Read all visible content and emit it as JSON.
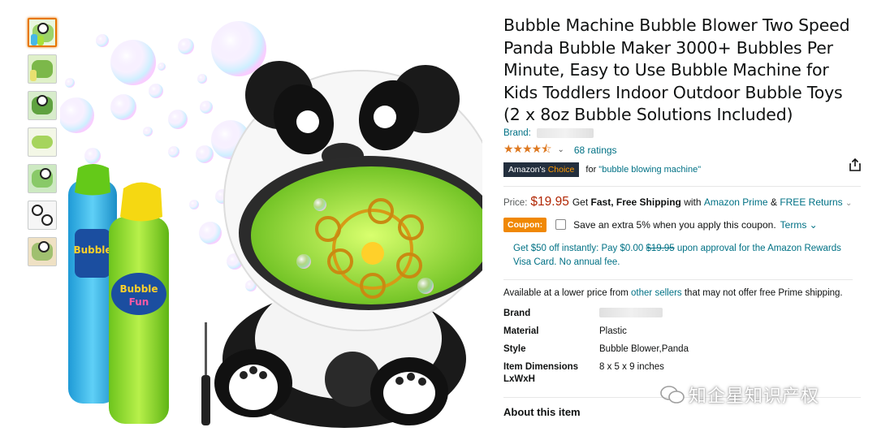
{
  "thumbnails": [
    {
      "label": "thumbnail-1",
      "selected": true
    },
    {
      "label": "thumbnail-2",
      "selected": false
    },
    {
      "label": "thumbnail-3",
      "selected": false
    },
    {
      "label": "thumbnail-4",
      "selected": false
    },
    {
      "label": "thumbnail-5",
      "selected": false
    },
    {
      "label": "thumbnail-6",
      "selected": false
    },
    {
      "label": "thumbnail-7",
      "selected": false
    }
  ],
  "main_image": {
    "bottle_label_1": "Bubble",
    "bottle_label_2": "Fun"
  },
  "product": {
    "title": "Bubble Machine Bubble Blower Two Speed Panda Bubble Maker 3000+ Bubbles Per Minute, Easy to Use Bubble Machine for Kids Toddlers Indoor Outdoor Bubble Toys (2 x 8oz Bubble Solutions Included)",
    "brand_label": "Brand:",
    "rating_stars": "★★★★⯪",
    "rating_chevron": "⌄",
    "ratings_count": "68 ratings",
    "choice_badge_prefix": "Amazon's ",
    "choice_badge_suffix": "Choice",
    "choice_for": "for",
    "choice_keyword": "\"bubble blowing machine\""
  },
  "price": {
    "label": "Price:",
    "value": "$19.95",
    "get": "Get",
    "shipping": "Fast, Free Shipping",
    "with": "with",
    "prime": "Amazon Prime",
    "amp": "&",
    "returns": "FREE Returns",
    "returns_chevron": "⌄"
  },
  "coupon": {
    "badge": "Coupon:",
    "text": "Save an extra 5% when you apply this coupon.",
    "terms": "Terms ⌄"
  },
  "promo": {
    "line1_a": "Get $50 off instantly: Pay $0.00 ",
    "strike": "$19.95",
    "line1_b": " upon approval for the Amazon Rewards Visa Card. No annual fee."
  },
  "availability": {
    "text_a": "Available at a lower price from ",
    "link": "other sellers",
    "text_b": " that may not offer free Prime shipping."
  },
  "specs": [
    {
      "key": "Brand",
      "value": ""
    },
    {
      "key": "Material",
      "value": "Plastic"
    },
    {
      "key": "Style",
      "value": "Bubble Blower,Panda"
    },
    {
      "key": "Item Dimensions LxWxH",
      "value": "8 x 5 x 9 inches"
    }
  ],
  "about": "About this item",
  "watermark": "知企星知识产权",
  "colors": {
    "link": "#007185",
    "price": "#b12704",
    "star": "#de7921",
    "coupon": "#f08804",
    "choice_bg": "#232f3e",
    "choice_accent": "#ff9900"
  },
  "icons": {
    "share": "share-icon"
  }
}
